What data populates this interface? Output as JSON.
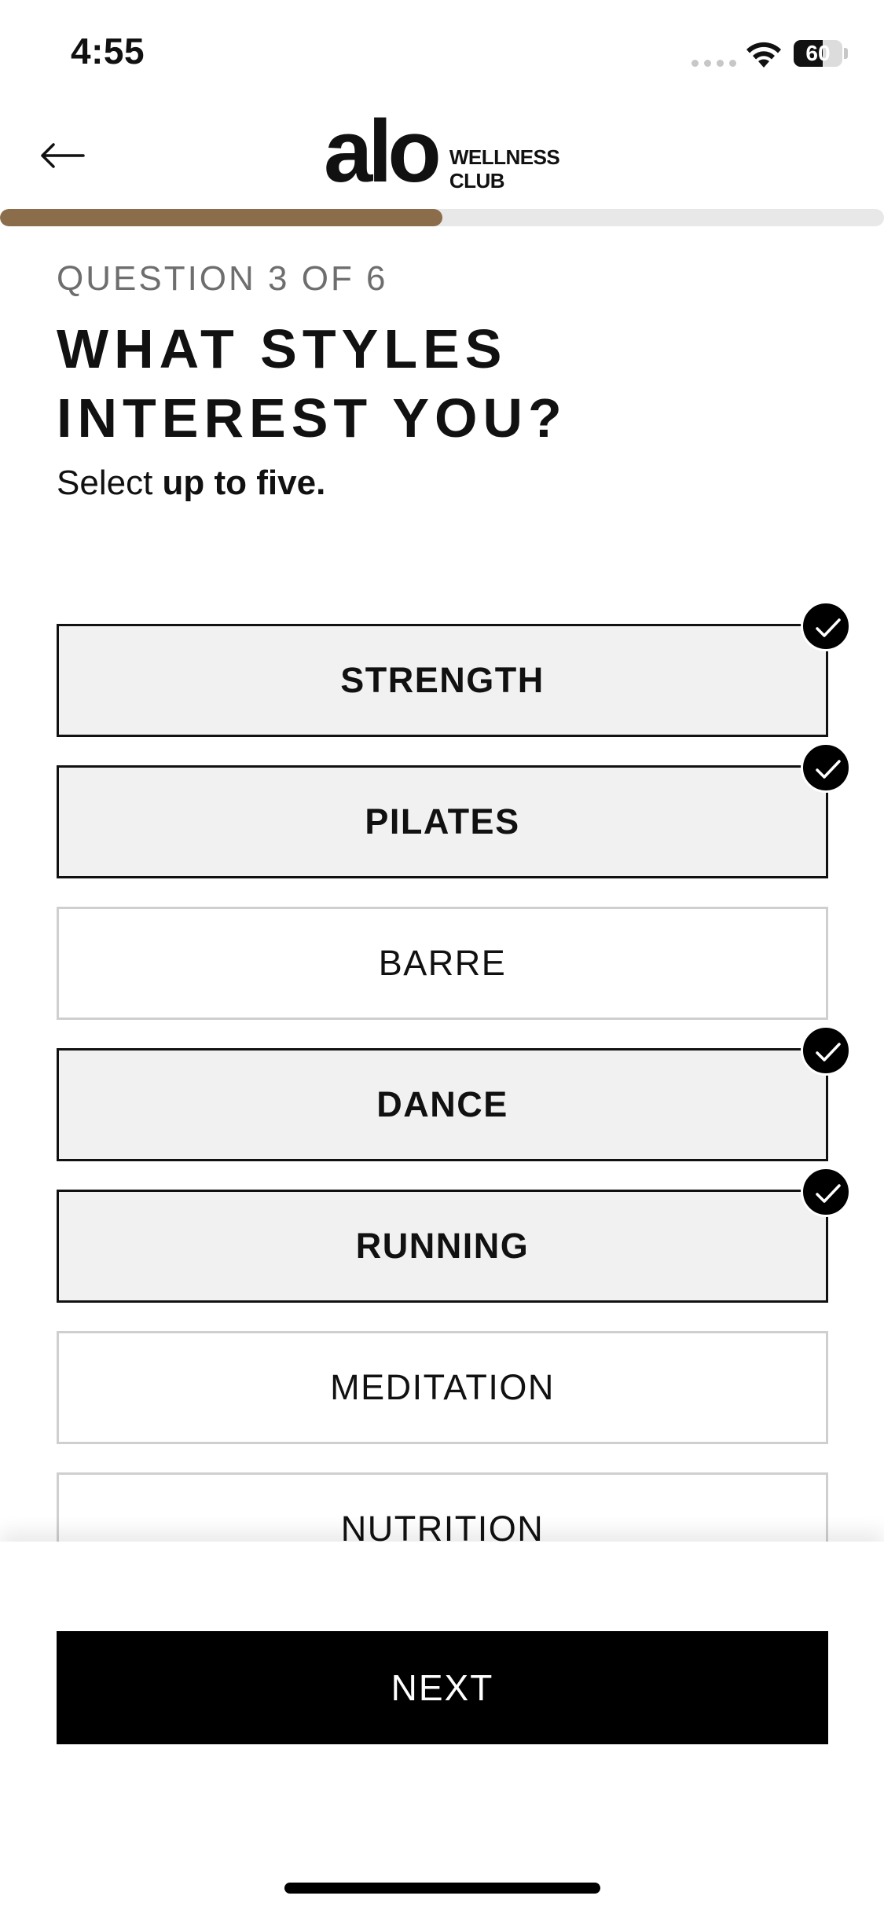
{
  "status_bar": {
    "time": "4:55",
    "battery_level": "60",
    "battery_fraction": 0.6,
    "icons": [
      "signal-icon",
      "wifi-icon",
      "battery-icon"
    ]
  },
  "header": {
    "back_icon": "arrow-left-icon",
    "logo": {
      "brand": "alo",
      "sub_line1": "WELLNESS",
      "sub_line2": "CLUB"
    }
  },
  "progress": {
    "current": 3,
    "total": 6,
    "fraction": 0.5,
    "color": "#8b6d4b"
  },
  "question": {
    "counter": "QUESTION 3 OF 6",
    "title": "WHAT STYLES INTEREST YOU?",
    "hint_prefix": "Select ",
    "hint_bold": "up to five."
  },
  "options": [
    {
      "label": "STRENGTH",
      "selected": true
    },
    {
      "label": "PILATES",
      "selected": true
    },
    {
      "label": "BARRE",
      "selected": false
    },
    {
      "label": "DANCE",
      "selected": true
    },
    {
      "label": "RUNNING",
      "selected": true
    },
    {
      "label": "MEDITATION",
      "selected": false
    },
    {
      "label": "NUTRITION",
      "selected": false
    }
  ],
  "footer": {
    "next_label": "NEXT"
  }
}
